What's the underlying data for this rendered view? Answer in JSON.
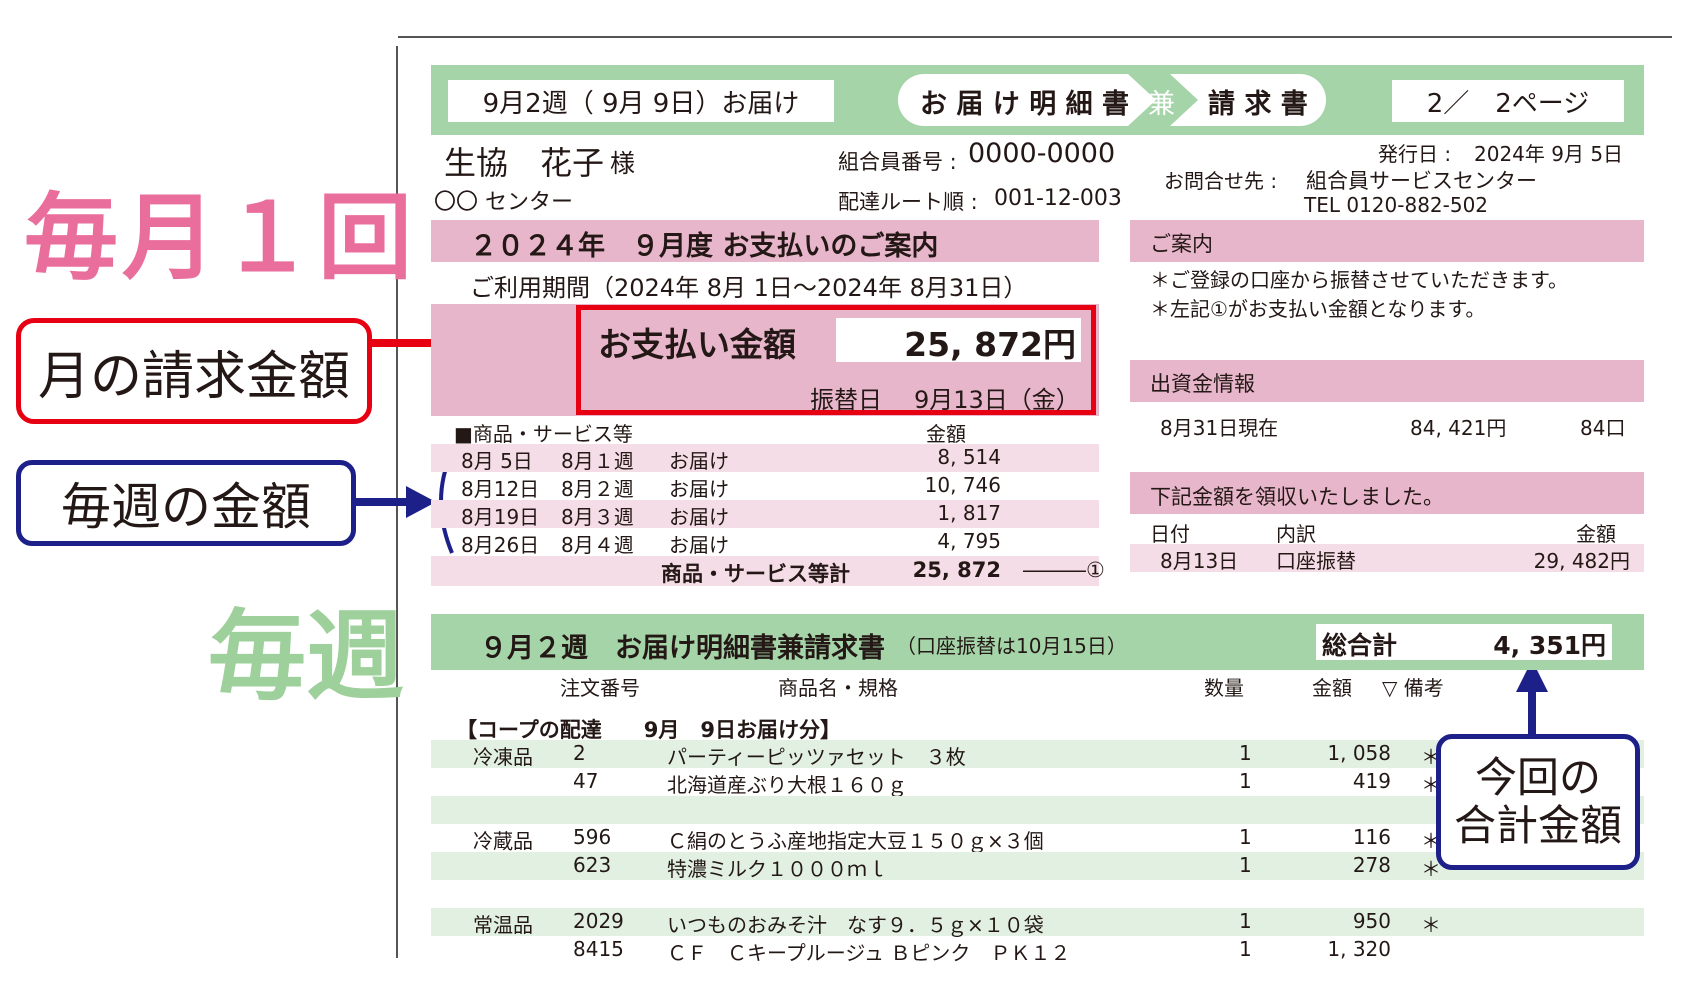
{
  "annotations": {
    "monthly_big": "毎月１回",
    "weekly_big": "毎週",
    "monthly_box": "月の請求金額",
    "weekly_box": "毎週の金額",
    "total_box_line1": "今回の",
    "total_box_line2": "合計金額"
  },
  "header": {
    "delivery_week": "9月2週（ 9月 9日）お届け",
    "title_left": "お 届 け 明 細 書",
    "title_mid": "兼",
    "title_right": "請 求 書",
    "page": "2／　2ページ"
  },
  "member": {
    "name": "生協　花子",
    "honorific": "様",
    "center": "〇〇 センター",
    "member_no_label": "組合員番号 :",
    "member_no": "0000-0000",
    "route_label": "配達ルート順 :",
    "route": "001-12-003",
    "issue_label": "発行日 :",
    "issue_date": "2024年  9月  5日",
    "contact_label": "お問合せ先 :",
    "contact_name": "組合員サービスセンター",
    "tel": "TEL  0120-882-502"
  },
  "monthly": {
    "title": "２０２４年　９月度 お支払いのご案内",
    "period": "ご利用期間（2024年  8月  1日～2024年  8月31日）",
    "pay_label": "お支払い金額",
    "pay_amount": "25, 872円",
    "transfer_label": "振替日",
    "transfer_date": "9月13日（金）",
    "table_head_left": "■商品・サービス等",
    "table_head_right": "金額",
    "rows": [
      {
        "date": "8月  5日",
        "week": "8月１週",
        "type": "お届け",
        "amount": "8, 514"
      },
      {
        "date": "8月12日",
        "week": "8月２週",
        "type": "お届け",
        "amount": "10, 746"
      },
      {
        "date": "8月19日",
        "week": "8月３週",
        "type": "お届け",
        "amount": "1, 817"
      },
      {
        "date": "8月26日",
        "week": "8月４週",
        "type": "お届け",
        "amount": "4, 795"
      }
    ],
    "subtotal_label": "商品・サービス等計",
    "subtotal_amount": "25, 872",
    "subtotal_ref": "―――①"
  },
  "notice": {
    "title": "ご案内",
    "line1": "＊ご登録の口座から振替させていただきます。",
    "line2": "＊左記①がお支払い金額となります。"
  },
  "investment": {
    "title": "出資金情報",
    "date": "8月31日現在",
    "amount": "84, 421円",
    "units": "84口"
  },
  "receipt": {
    "title": "下記金額を領収いたしました。",
    "col_date": "日付",
    "col_detail": "内訳",
    "col_amount": "金額",
    "date": "8月13日",
    "detail": "口座振替",
    "amount": "29, 482円"
  },
  "weekly": {
    "title": "９月２週　お届け明細書兼請求書",
    "note": "（口座振替は10月15日）",
    "total_label": "総合計",
    "total_amount": "4, 351円",
    "col_order": "注文番号",
    "col_item": "商品名・規格",
    "col_qty": "数量",
    "col_amount": "金額",
    "col_remark": "▽ 備考",
    "section": "【コープの配達　　9月　9日お届け分】",
    "rows": [
      {
        "cat": "冷凍品",
        "no": "2",
        "item": "パーティーピッツァセット　３枚",
        "qty": "1",
        "amount": "1, 058",
        "mark": "＊"
      },
      {
        "cat": "",
        "no": "47",
        "item": "北海道産ぶり大根１６０ｇ",
        "qty": "1",
        "amount": "419",
        "mark": "＊"
      },
      {
        "cat": "",
        "no": "",
        "item": "",
        "qty": "",
        "amount": "",
        "mark": ""
      },
      {
        "cat": "冷蔵品",
        "no": "596",
        "item": "Ｃ絹のとうふ産地指定大豆１５０ｇ×３個",
        "qty": "1",
        "amount": "116",
        "mark": "＊"
      },
      {
        "cat": "",
        "no": "623",
        "item": "特濃ミルク１０００ｍｌ",
        "qty": "1",
        "amount": "278",
        "mark": "＊"
      },
      {
        "cat": "",
        "no": "",
        "item": "",
        "qty": "",
        "amount": "",
        "mark": ""
      },
      {
        "cat": "常温品",
        "no": "2029",
        "item": "いつものおみそ汁　なす９．５ｇ×１０袋",
        "qty": "1",
        "amount": "950",
        "mark": "＊"
      },
      {
        "cat": "",
        "no": "8415",
        "item": "ＣＦ　Ｃキープルージュ Ｂピンク　ＰＫ１２",
        "qty": "1",
        "amount": "1, 320",
        "mark": ""
      }
    ]
  },
  "colors": {
    "pink": "#e8b6cb",
    "light_pink": "#f5dde7",
    "green": "#a5d4a8",
    "light_green": "#e1f0e1",
    "red": "#e60012",
    "navy": "#1d2088",
    "annotation_pink": "#ea6e9c",
    "annotation_green": "#9dd09b"
  }
}
